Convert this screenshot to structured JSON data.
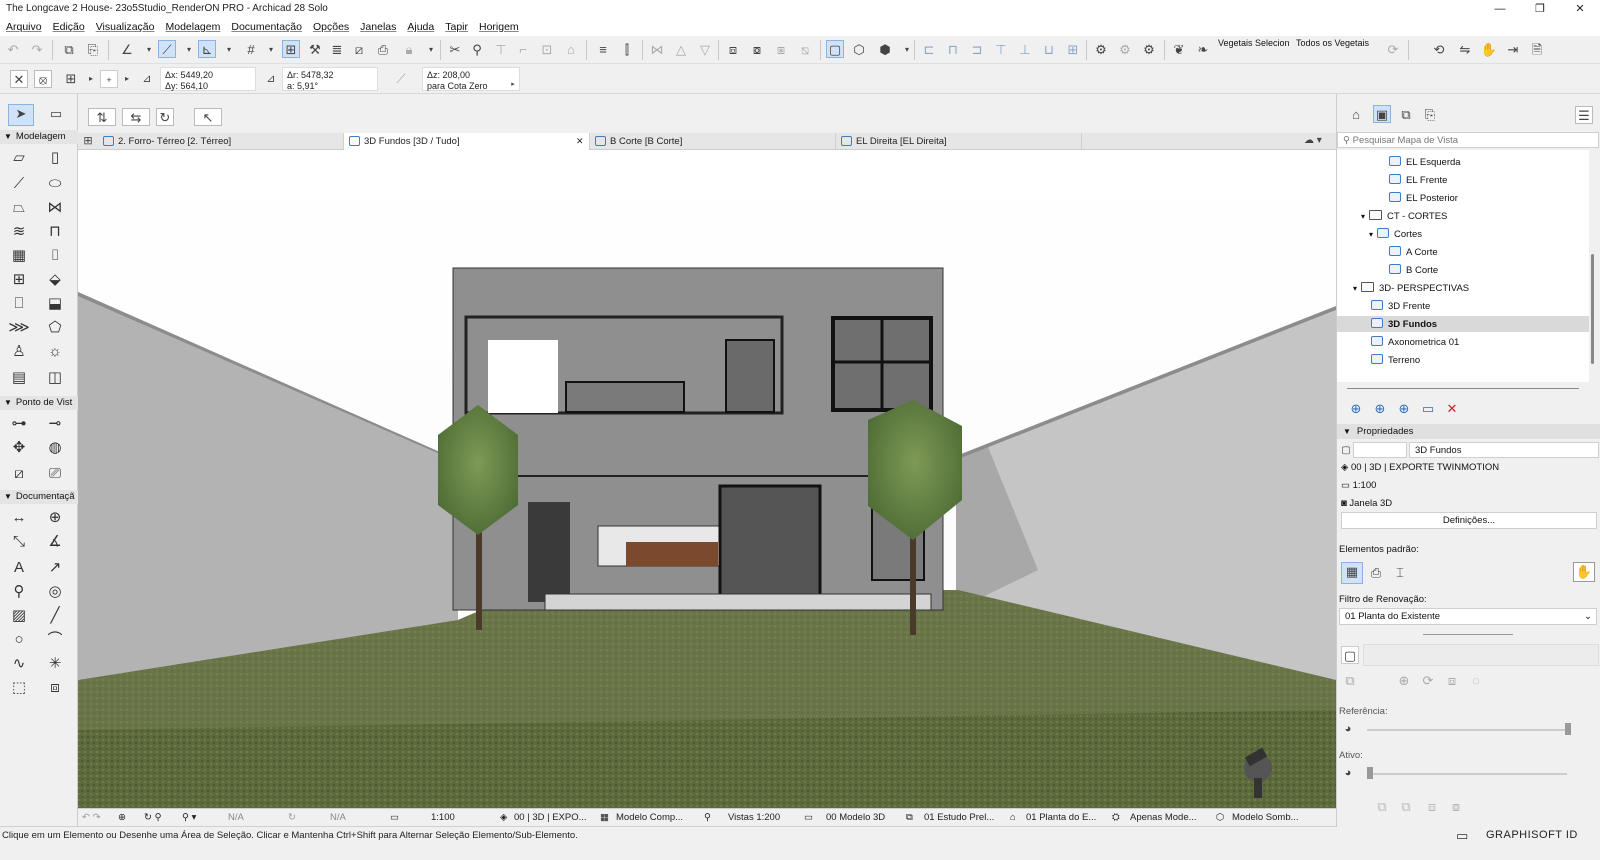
{
  "window": {
    "title": "The Longcave 2 House- 23o5Studio_RenderON PRO - Archicad 28 Solo",
    "controls": [
      "—",
      "❐",
      "✕"
    ]
  },
  "menu": [
    "Arquivo",
    "Edição",
    "Visualização",
    "Modelagem",
    "Documentação",
    "Opções",
    "Janelas",
    "Ajuda",
    "Tapir",
    "Horigem"
  ],
  "toolbar": {
    "vegetais_selecion": "Vegetais Selecion",
    "todos_vegetais": "Todos os Vegetais"
  },
  "coords": {
    "dx": "Δx: 5449,20",
    "dy": "Δy: 564,10",
    "dr": "Δr: 5478,32",
    "a": "a: 5,91°",
    "dz": "Δz: 208,00",
    "ref": "para Cota Zero"
  },
  "palettes": {
    "modelagem": "Modelagem",
    "ponto_vista": "Ponto de Vist",
    "documentacao": "Documentaçã"
  },
  "tabs": [
    {
      "label": "2. Forro- Térreo [2. Térreo]"
    },
    {
      "label": "3D Fundos [3D / Tudo]"
    },
    {
      "label": "B Corte [B Corte]"
    },
    {
      "label": "EL Direita [EL Direita]"
    }
  ],
  "viewmap": {
    "search_placeholder": "Pesquisar Mapa de Vista",
    "items": [
      {
        "label": "EL Esquerda"
      },
      {
        "label": "EL Frente"
      },
      {
        "label": "EL Posterior"
      },
      {
        "label": "CT - CORTES"
      },
      {
        "label": "Cortes"
      },
      {
        "label": "A Corte"
      },
      {
        "label": "B Corte"
      },
      {
        "label": "3D- PERSPECTIVAS"
      },
      {
        "label": "3D Frente"
      },
      {
        "label": "3D Fundos"
      },
      {
        "label": "Axonometrica 01"
      },
      {
        "label": "Terreno"
      }
    ]
  },
  "properties": {
    "header": "Propriedades",
    "name": "3D Fundos",
    "layer_combo": "00 | 3D | EXPORTE TWINMOTION",
    "scale": "1:100",
    "window_type": "Janela 3D",
    "settings_button": "Definições...",
    "default_elements": "Elementos padrão:",
    "renovation_filter_label": "Filtro de Renovação:",
    "renovation_filter_value": "01 Planta do Existente",
    "reference_label": "Referência:",
    "active_label": "Ativo:"
  },
  "statusbar": {
    "na1": "N/A",
    "na2": "N/A",
    "scale": "1:100",
    "layer": "00 | 3D | EXPO...",
    "model": "Modelo Comp...",
    "views": "Vistas 1:200",
    "model3d": "00 Modelo 3D",
    "study": "01 Estudo Prel...",
    "plan": "01 Planta do E...",
    "only_model": "Apenas Mode...",
    "shadow_model": "Modelo Somb..."
  },
  "hint": "Clique em um Elemento ou Desenhe uma Área de Seleção. Clicar e Mantenha Ctrl+Shift para Alternar Seleção Elemento/Sub-Elemento.",
  "brand": "GRAPHISOFT ID",
  "colors": {
    "accent": "#3d7cc9",
    "delete": "#d0202a",
    "grass": "#5e6e3a",
    "wall": "#a9a9a9"
  }
}
